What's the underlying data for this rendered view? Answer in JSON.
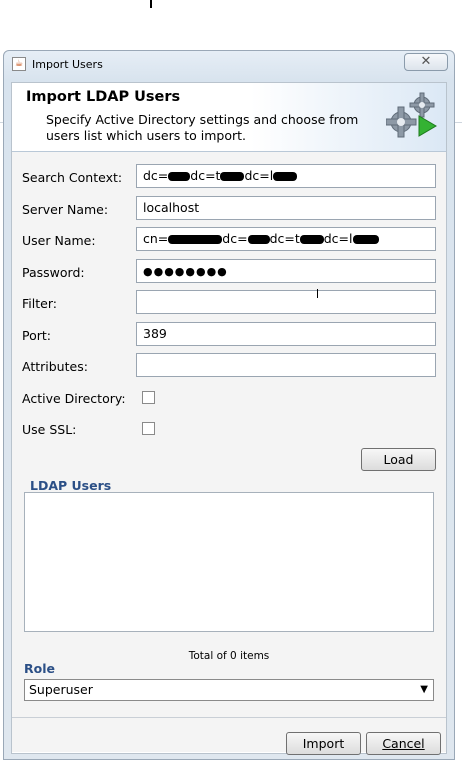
{
  "window": {
    "title": "Import Users",
    "close_glyph": "✕",
    "app_icon": "java-icon"
  },
  "header": {
    "title": "Import LDAP Users",
    "description": "Specify Active Directory settings and choose from users list which users to import.",
    "icon": "gears-icon"
  },
  "form": {
    "search_context": {
      "label": "Search Context:",
      "value_parts": [
        "dc=",
        "dc=t",
        "dc=l"
      ]
    },
    "server_name": {
      "label": "Server Name:",
      "value": "localhost"
    },
    "user_name": {
      "label": "User Name:",
      "value_parts": [
        "cn=",
        "dc=",
        "dc=t",
        "dc=l"
      ]
    },
    "password": {
      "label": "Password:",
      "value": "●●●●●●●●"
    },
    "filter": {
      "label": "Filter:",
      "value": ""
    },
    "port": {
      "label": "Port:",
      "value": "389"
    },
    "attributes": {
      "label": "Attributes:",
      "value": ""
    },
    "active_directory": {
      "label": "Active Directory:",
      "checked": false
    },
    "use_ssl": {
      "label": "Use SSL:",
      "checked": false
    }
  },
  "load_button": "Load",
  "ldap_users": {
    "title": "LDAP Users",
    "items": [],
    "total_text": "Total of 0 items"
  },
  "role": {
    "label": "Role",
    "selected": "Superuser",
    "arrow": "▼"
  },
  "footer": {
    "import_label": "Import",
    "cancel_label": "Cancel"
  }
}
